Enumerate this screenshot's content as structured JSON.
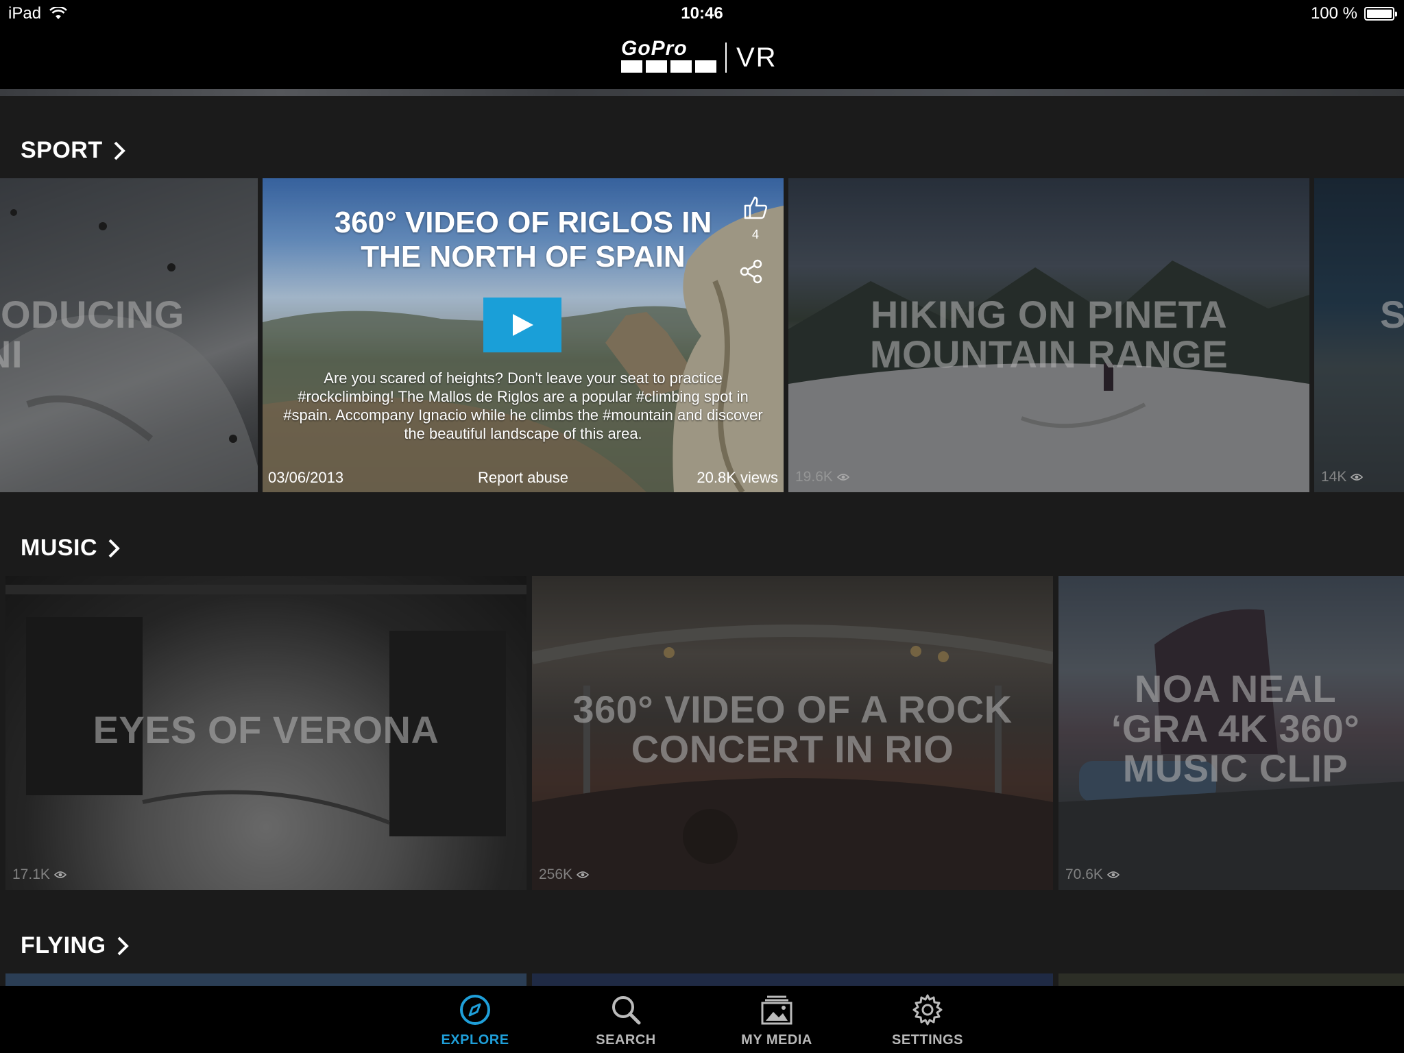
{
  "status_bar": {
    "device": "iPad",
    "time": "10:46",
    "battery": "100 %"
  },
  "header": {
    "brand": "GoPro",
    "product": "VR"
  },
  "sections": [
    {
      "title": "SPORT",
      "cards": [
        {
          "title": "RODUCING\nINI",
          "views": ""
        },
        {
          "featured": true,
          "title": "360° VIDEO OF RIGLOS IN THE NORTH OF SPAIN",
          "likes": "4",
          "description": "Are you scared of heights? Don't leave your seat to practice #rockclimbing! The Mallos de Riglos are a popular #climbing spot in #spain. Accompany Ignacio while he climbs the #mountain and discover the beautiful landscape of this area.",
          "date": "03/06/2013",
          "report": "Report abuse",
          "views": "20.8K views"
        },
        {
          "title": "HIKING ON PINETA MOUNTAIN RANGE",
          "views": "19.6K"
        },
        {
          "title": "S",
          "views": "14K"
        }
      ]
    },
    {
      "title": "MUSIC",
      "cards": [
        {
          "title": "EYES OF VERONA",
          "views": "17.1K"
        },
        {
          "title": "360° VIDEO OF A ROCK CONCERT IN RIO",
          "views": "256K"
        },
        {
          "title": "NOA NEAL ‘GRA 4K 360° MUSIC CLIP",
          "views": "70.6K"
        }
      ]
    },
    {
      "title": "FLYING"
    }
  ],
  "tabs": [
    {
      "label": "EXPLORE",
      "icon": "compass-icon",
      "active": true
    },
    {
      "label": "SEARCH",
      "icon": "search-icon"
    },
    {
      "label": "MY MEDIA",
      "icon": "media-icon"
    },
    {
      "label": "SETTINGS",
      "icon": "gear-icon"
    }
  ],
  "colors": {
    "accent": "#1f9fd9",
    "background": "#1b1b1b",
    "bar": "#000000"
  }
}
